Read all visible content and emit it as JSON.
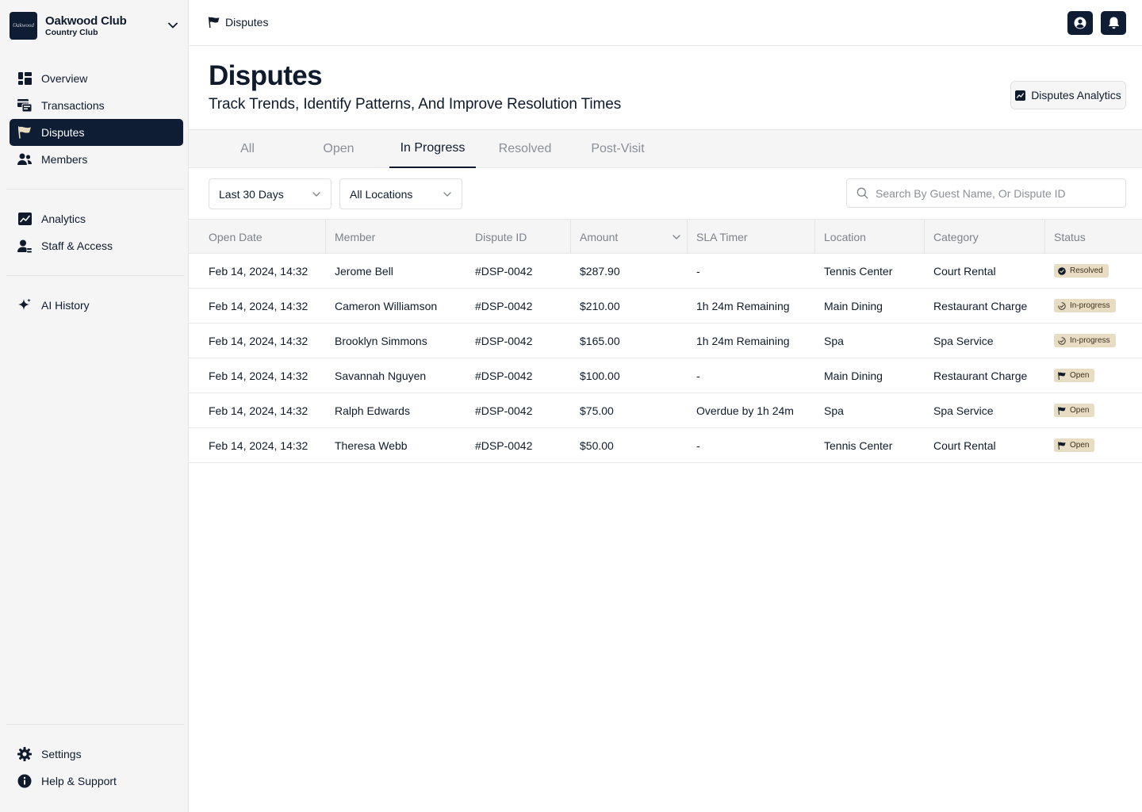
{
  "sidebar": {
    "club_name": "Oakwood Club",
    "club_type": "Country Club",
    "logo_text": "Oakwood",
    "nav_main": [
      {
        "label": "Overview",
        "icon": "overview-icon"
      },
      {
        "label": "Transactions",
        "icon": "transactions-icon"
      },
      {
        "label": "Disputes",
        "icon": "flag-icon",
        "active": true
      },
      {
        "label": "Members",
        "icon": "members-icon"
      }
    ],
    "nav_secondary": [
      {
        "label": "Analytics",
        "icon": "chart-icon"
      },
      {
        "label": "Staff & Access",
        "icon": "staff-icon"
      }
    ],
    "nav_ai": [
      {
        "label": "AI History",
        "icon": "sparkle-icon"
      }
    ],
    "nav_bottom": [
      {
        "label": "Settings",
        "icon": "gear-icon"
      },
      {
        "label": "Help & Support",
        "icon": "info-icon"
      }
    ]
  },
  "topbar": {
    "breadcrumb": "Disputes"
  },
  "header": {
    "title": "Disputes",
    "subtitle": "Track Trends, Identify Patterns, And Improve Resolution Times",
    "analytics_button": "Disputes Analytics"
  },
  "tabs": [
    {
      "label": "All"
    },
    {
      "label": "Open"
    },
    {
      "label": "In Progress",
      "active": true
    },
    {
      "label": "Resolved"
    },
    {
      "label": "Post-Visit"
    }
  ],
  "filters": {
    "date_range": "Last 30 Days",
    "location": "All Locations",
    "search_placeholder": "Search By Guest Name, Or Dispute ID"
  },
  "table": {
    "columns": [
      "Open Date",
      "Member",
      "Dispute ID",
      "Amount",
      "SLA Timer",
      "Location",
      "Category",
      "Status"
    ],
    "rows": [
      {
        "date": "Feb 14, 2024, 14:32",
        "member": "Jerome Bell",
        "id": "#DSP-0042",
        "amount": "$287.90",
        "sla": "-",
        "location": "Tennis Center",
        "category": "Court Rental",
        "status": "Resolved"
      },
      {
        "date": "Feb 14, 2024, 14:32",
        "member": "Cameron Williamson",
        "id": "#DSP-0042",
        "amount": "$210.00",
        "sla": "1h 24m Remaining",
        "location": "Main Dining",
        "category": "Restaurant Charge",
        "status": "In-progress"
      },
      {
        "date": "Feb 14, 2024, 14:32",
        "member": "Brooklyn Simmons",
        "id": "#DSP-0042",
        "amount": "$165.00",
        "sla": "1h 24m Remaining",
        "location": "Spa",
        "category": "Spa Service",
        "status": "In-progress"
      },
      {
        "date": "Feb 14, 2024, 14:32",
        "member": "Savannah Nguyen",
        "id": "#DSP-0042",
        "amount": "$100.00",
        "sla": "-",
        "location": "Main Dining",
        "category": "Restaurant Charge",
        "status": "Open"
      },
      {
        "date": "Feb 14, 2024, 14:32",
        "member": "Ralph Edwards",
        "id": "#DSP-0042",
        "amount": "$75.00",
        "sla": "Overdue by 1h 24m",
        "location": "Spa",
        "category": "Spa Service",
        "status": "Open"
      },
      {
        "date": "Feb 14, 2024, 14:32",
        "member": "Theresa Webb",
        "id": "#DSP-0042",
        "amount": "$50.00",
        "sla": "-",
        "location": "Tennis Center",
        "category": "Court Rental",
        "status": "Open"
      }
    ]
  },
  "colors": {
    "navy": "#0e1c34",
    "badge_bg": "#e8dcc2",
    "muted_text": "#8a8f98"
  }
}
